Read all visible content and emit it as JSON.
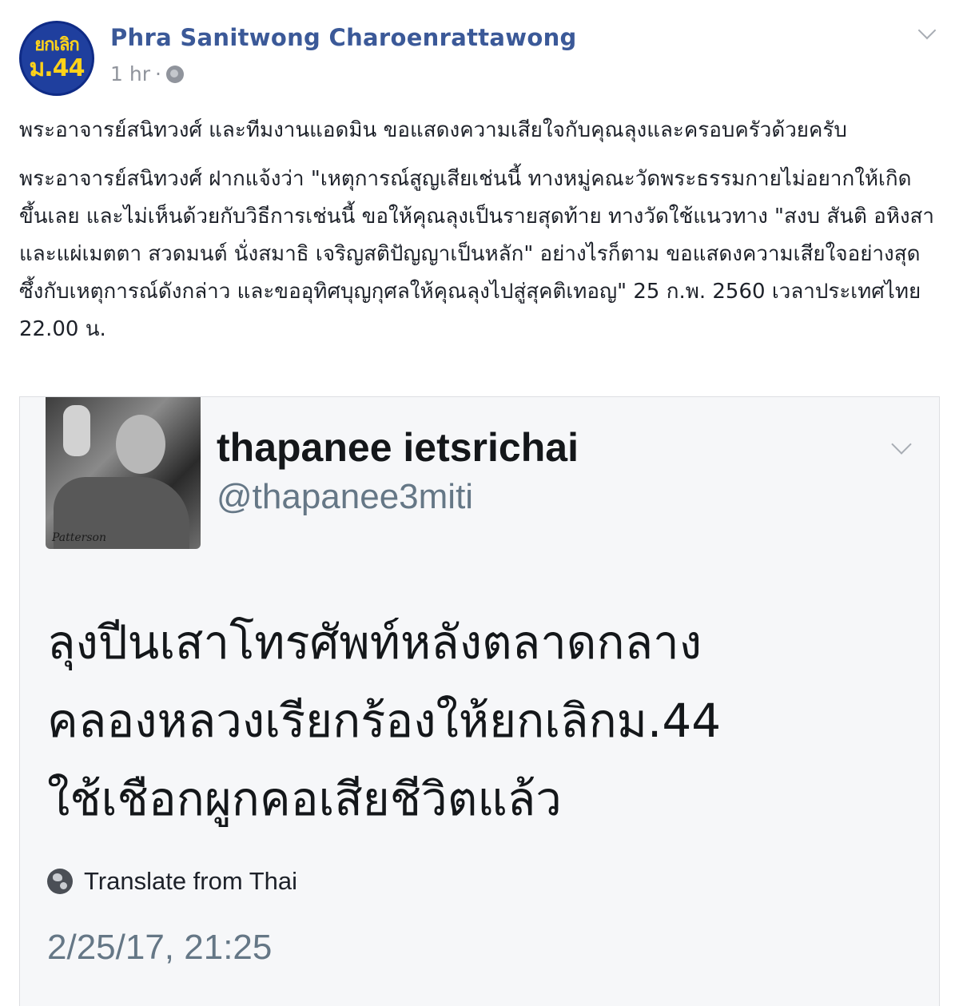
{
  "post": {
    "page_name": "Phra Sanitwong Charoenrattawong",
    "avatar_text_top": "ยกเลิก",
    "avatar_text_bottom": "ม.44",
    "time": "1 hr",
    "separator": "·",
    "privacy_icon": "globe-icon",
    "paragraphs": [
      "พระอาจารย์สนิทวงศ์ และทีมงานแอดมิน ขอแสดงความเสียใจกับคุณลุงและครอบครัวด้วยครับ",
      "พระอาจารย์สนิทวงศ์ ฝากแจ้งว่า \"เหตุการณ์สูญเสียเช่นนี้ ทางหมู่คณะวัดพระธรรมกายไม่อยากให้เกิดขึ้นเลย และไม่เห็นด้วยกับวิธีการเช่นนี้ ขอให้คุณลุงเป็นรายสุดท้าย ทางวัดใช้แนวทาง \"สงบ สันติ อหิงสา และแผ่เมตตา สวดมนต์ นั่งสมาธิ เจริญสติปัญญาเป็นหลัก\" อย่างไรก็ตาม ขอแสดงความเสียใจอย่างสุดซึ้งกับเหตุการณ์ดังกล่าว และขออุทิศบุญกุศลให้คุณลุงไปสู่สุคติเทอญ\" 25 ก.พ. 2560 เวลาประเทศไทย 22.00 น."
    ]
  },
  "tweet": {
    "display_name": "thapanee ietsrichai",
    "handle": "@thapanee3miti",
    "avatar_signature": "Patterson",
    "text_lines": [
      "ลุงปีนเสาโทรศัพท์หลังตลาดกลาง",
      "คลองหลวงเรียกร้องให้ยกเลิกม.44",
      "ใช้เชือกผูกคอเสียชีวิตแล้ว"
    ],
    "translate_label": "Translate from Thai",
    "timestamp": "2/25/17, 21:25"
  },
  "colors": {
    "link_blue": "#3b5998",
    "meta_gray": "#90949c",
    "twitter_gray": "#657786",
    "avatar_blue": "#1f3f9e",
    "avatar_yellow": "#ffd21a"
  }
}
